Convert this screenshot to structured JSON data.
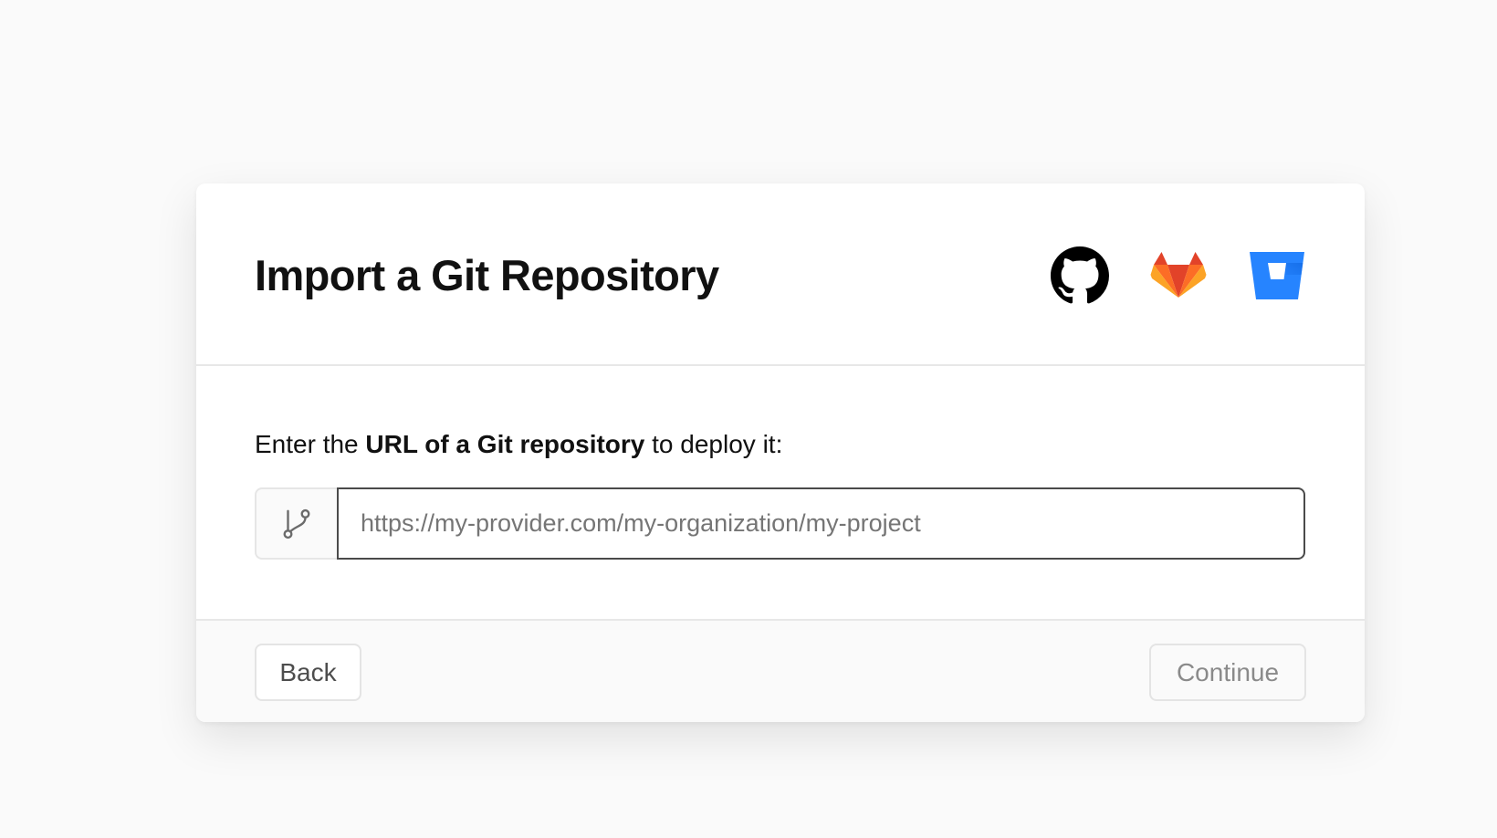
{
  "dialog": {
    "title": "Import a Git Repository",
    "providers": [
      {
        "name": "GitHub",
        "icon": "github-icon"
      },
      {
        "name": "GitLab",
        "icon": "gitlab-icon"
      },
      {
        "name": "Bitbucket",
        "icon": "bitbucket-icon"
      }
    ]
  },
  "body": {
    "instruction_prefix": "Enter the ",
    "instruction_bold": "URL of a Git repository",
    "instruction_suffix": " to deploy it:",
    "url_input": {
      "value": "",
      "placeholder": "https://my-provider.com/my-organization/my-project",
      "prefix_icon": "git-branch-icon"
    }
  },
  "footer": {
    "back_label": "Back",
    "continue_label": "Continue",
    "continue_disabled": true
  },
  "colors": {
    "page_background": "#fafafa",
    "gitlab_orange": "#FC6D26",
    "gitlab_red": "#E24329",
    "gitlab_yellow": "#FCA326",
    "bitbucket_blue": "#0052CC",
    "input_border": "#4a4a4a"
  }
}
